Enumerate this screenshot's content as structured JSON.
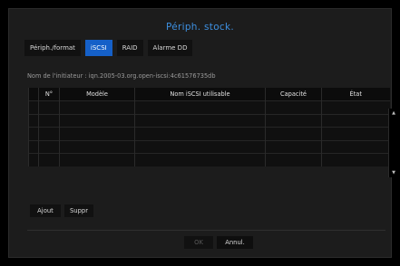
{
  "dialog": {
    "title": "Périph. stock."
  },
  "tabs": [
    {
      "label": "Périph./format",
      "active": false
    },
    {
      "label": "iSCSI",
      "active": true
    },
    {
      "label": "RAID",
      "active": false
    },
    {
      "label": "Alarme DD",
      "active": false
    }
  ],
  "initiator": {
    "text": "Nom de l'initiateur : iqn.2005-03.org.open-iscsi:4c61576735db"
  },
  "table": {
    "columns": [
      "",
      "N°",
      "Modèle",
      "Nom iSCSI utilisable",
      "Capacité",
      "État"
    ],
    "rows": [
      [
        "",
        "",
        "",
        "",
        "",
        ""
      ],
      [
        "",
        "",
        "",
        "",
        "",
        ""
      ],
      [
        "",
        "",
        "",
        "",
        "",
        ""
      ],
      [
        "",
        "",
        "",
        "",
        "",
        ""
      ],
      [
        "",
        "",
        "",
        "",
        "",
        ""
      ]
    ]
  },
  "scroll": {
    "up_icon": "triangle-up",
    "down_icon": "triangle-down",
    "up_glyph": "▲",
    "down_glyph": "▼"
  },
  "actions": {
    "add_label": "Ajout",
    "delete_label": "Suppr"
  },
  "footer": {
    "ok_label": "OK",
    "cancel_label": "Annul."
  },
  "colors": {
    "accent": "#1560c8",
    "title": "#3d8fe0",
    "background": "#1c1c1c"
  }
}
